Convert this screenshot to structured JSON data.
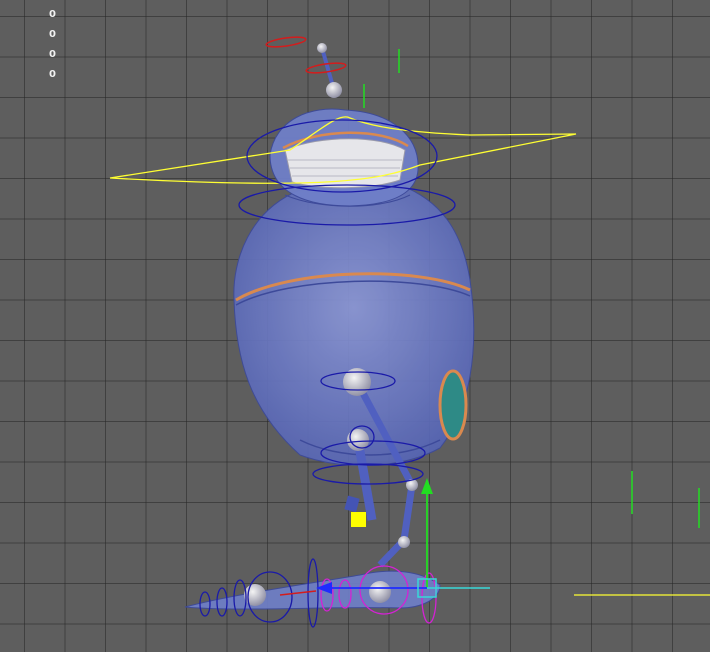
{
  "hud": {
    "readouts": [
      "0",
      "0",
      "0",
      "0"
    ]
  },
  "colors": {
    "grid_bg": "#5e5e5e",
    "grid_line": "#2a2a2a",
    "mesh_body": "#6f7fc8",
    "mesh_dark": "#3d4a9a",
    "accent_orange": "#d9894f",
    "curve_yellow": "#ffff33",
    "control_blue": "#1a1aa8",
    "control_magenta": "#d422d4",
    "axis_green": "#22dd22",
    "axis_blue": "#1f2bff",
    "axis_cyan": "#38d8d8",
    "axis_red": "#d41c1c",
    "locator_yellow": "#ffff00"
  },
  "icons": {
    "move_manipulator": "translate-manipulator-icon",
    "locator": "locator-icon"
  }
}
